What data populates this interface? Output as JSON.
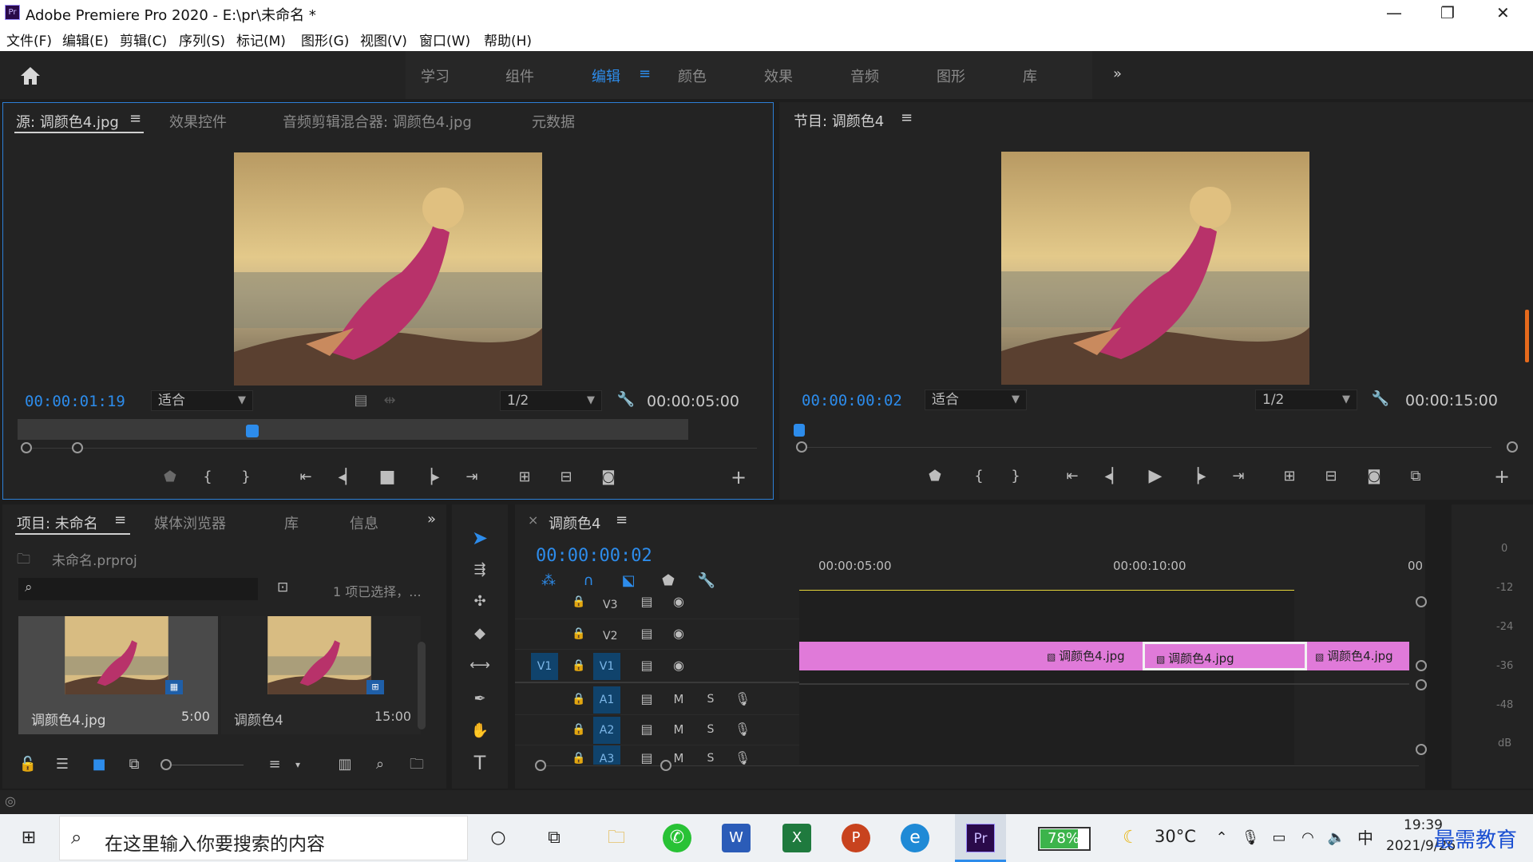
{
  "titlebar": {
    "title": "Adobe Premiere Pro 2020 - E:\\pr\\未命名 *",
    "logo": "Pr",
    "minimize": "—",
    "restore": "❐",
    "close": "✕"
  },
  "menu": [
    "文件(F)",
    "编辑(E)",
    "剪辑(C)",
    "序列(S)",
    "标记(M)",
    "图形(G)",
    "视图(V)",
    "窗口(W)",
    "帮助(H)"
  ],
  "workspaces": {
    "home_icon": "home-icon",
    "tabs": [
      "学习",
      "组件",
      "编辑",
      "颜色",
      "效果",
      "音频",
      "图形",
      "库"
    ],
    "active": "编辑",
    "more": "»"
  },
  "source": {
    "tabs": [
      "源: 调颜色4.jpg",
      "效果控件",
      "音频剪辑混合器: 调颜色4.jpg",
      "元数据"
    ],
    "timecode": "00:00:01:19",
    "fit": "适合",
    "resolution": "1/2",
    "duration": "00:00:05:00",
    "playhead_fraction": 0.35
  },
  "program": {
    "tab": "节目: 调颜色4",
    "timecode": "00:00:00:02",
    "fit": "适合",
    "resolution": "1/2",
    "duration": "00:00:15:00",
    "playhead_fraction": 0.0
  },
  "project": {
    "tabs": [
      "项目: 未命名",
      "媒体浏览器",
      "库",
      "信息"
    ],
    "file": "未命名.prproj",
    "selection": "1 项已选择，...",
    "search_placeholder": "",
    "items": [
      {
        "name": "调颜色4.jpg",
        "duration": "5:00"
      },
      {
        "name": "调颜色4",
        "duration": "15:00"
      }
    ]
  },
  "timeline": {
    "tab": "调颜色4",
    "timecode": "00:00:00:02",
    "ruler": [
      "00:00:05:00",
      "00:00:10:00",
      "00"
    ],
    "video_tracks": [
      "V3",
      "V2",
      "V1"
    ],
    "audio_tracks": [
      "A1",
      "A2",
      "A3"
    ],
    "source_patch": "V1",
    "mute": "M",
    "solo": "S",
    "clips": [
      "调颜色4.jpg",
      "调颜色4.jpg",
      "调颜色4.jpg"
    ]
  },
  "meter": {
    "labels": [
      "0",
      "-12",
      "-24",
      "-36",
      "-48",
      "dB"
    ]
  },
  "taskbar": {
    "search_placeholder": "在这里输入你要搜索的内容",
    "battery": "78%",
    "weather": "30°C",
    "ime": "中",
    "time": "19:39",
    "date": "2021/9/26",
    "watermark": "最需教育"
  },
  "colors": {
    "accent": "#2d8ceb",
    "clip": "#e07ad9",
    "panel": "#232323"
  }
}
